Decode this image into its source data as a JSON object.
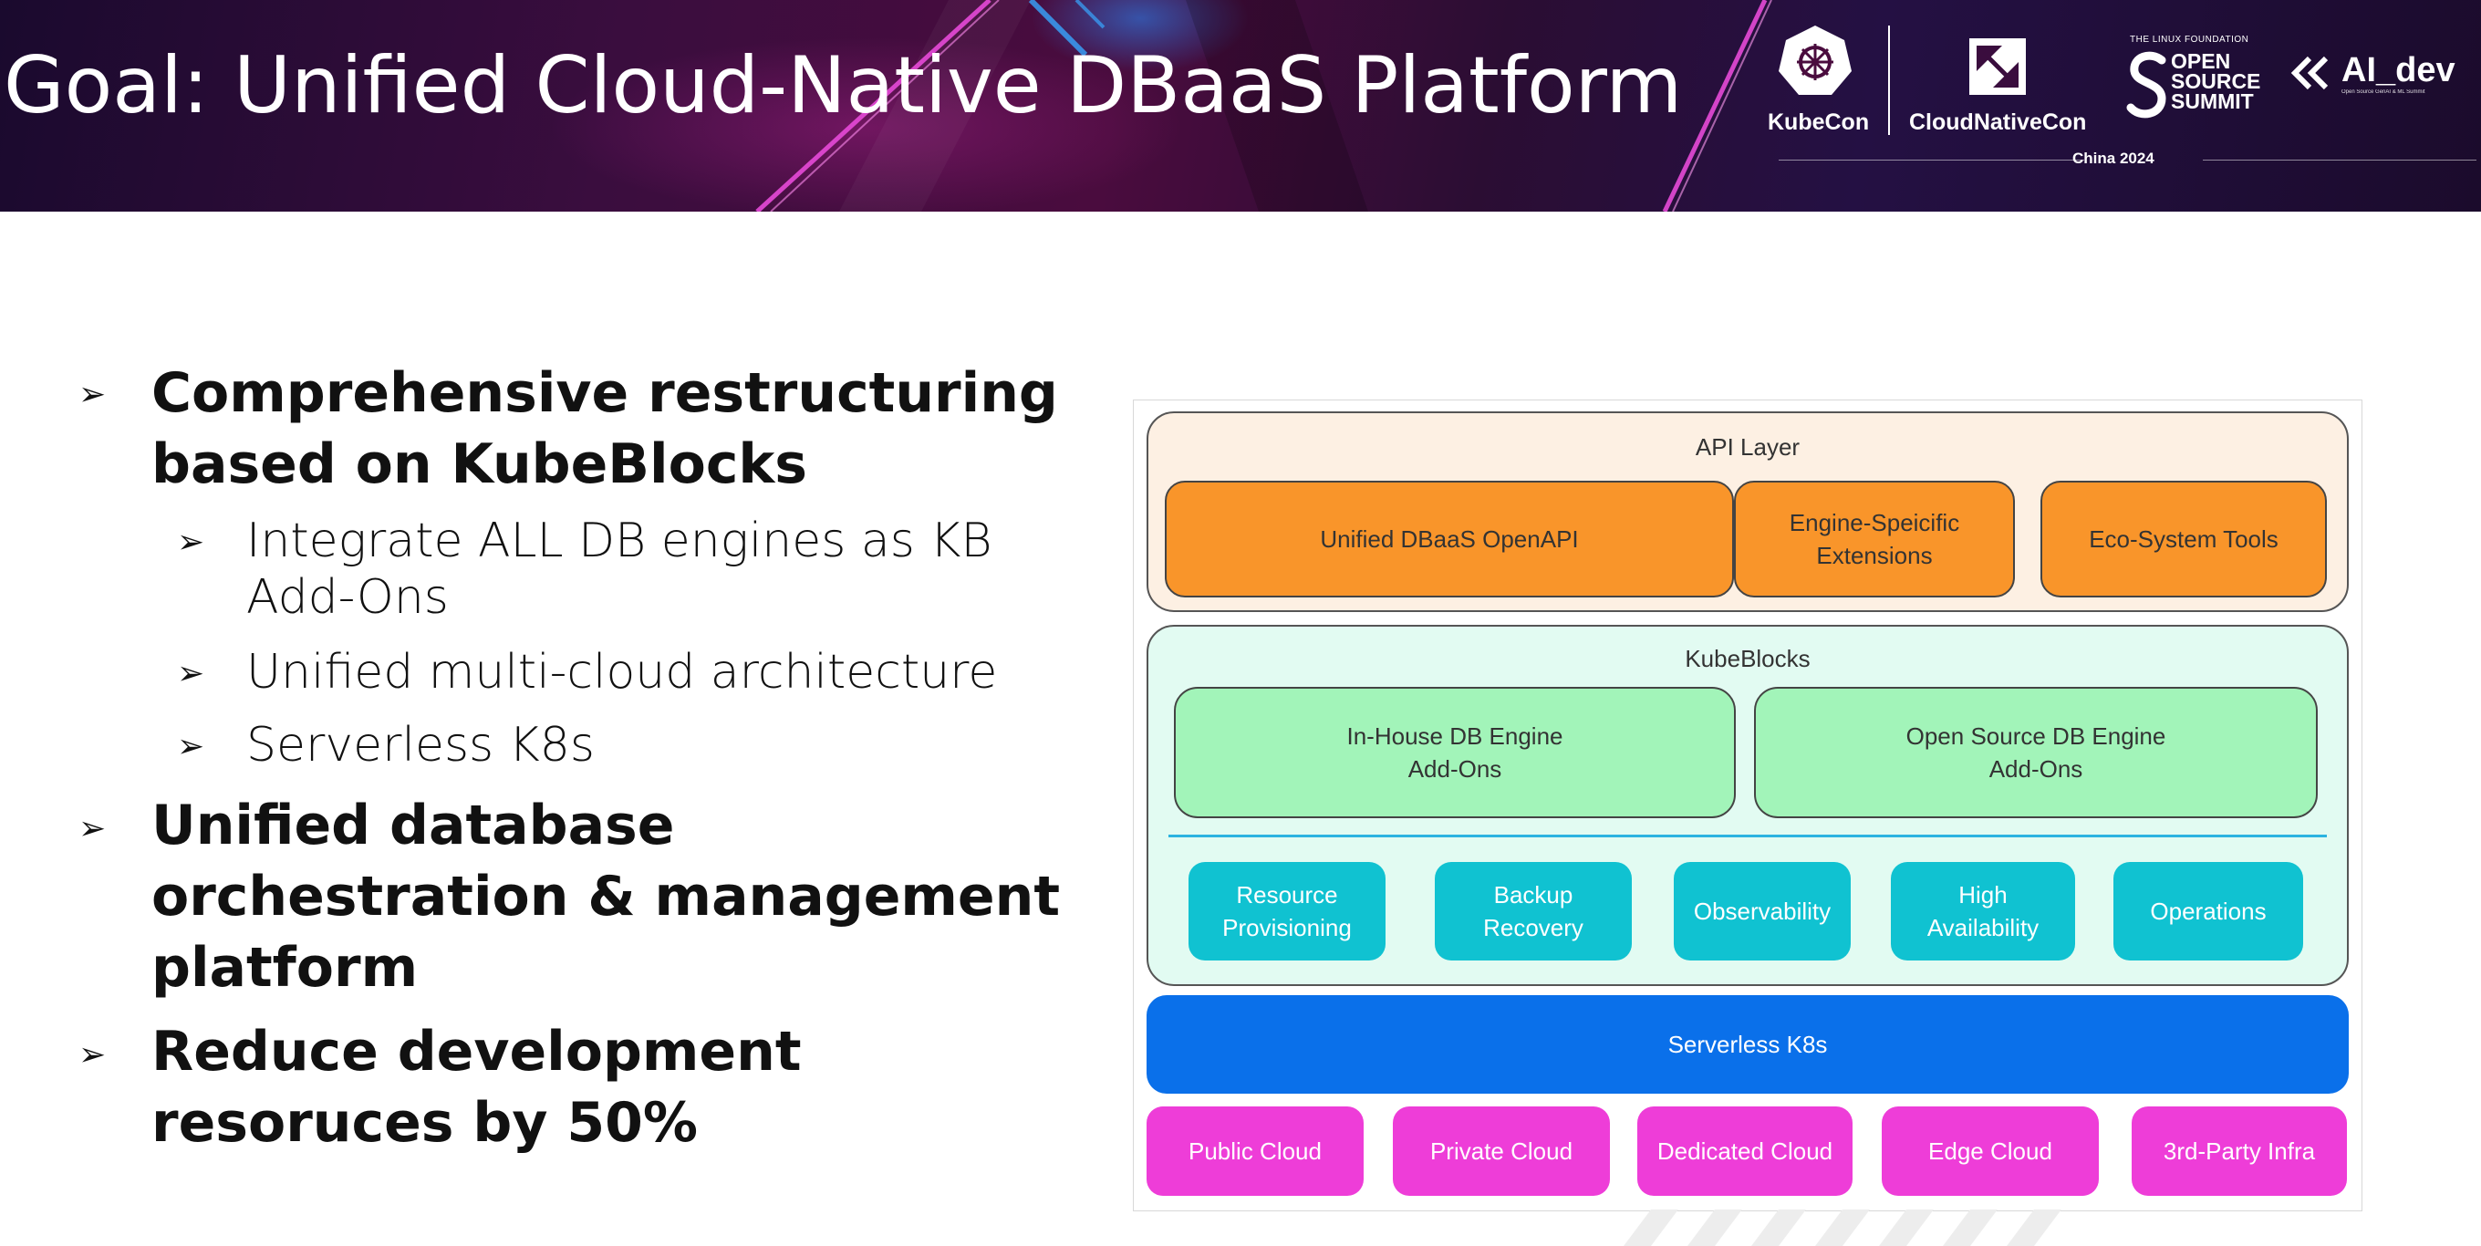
{
  "header": {
    "title": "Goal: Unified Cloud-Native DBaaS Platform",
    "logos": {
      "kubecon": "KubeCon",
      "cloudnativecon": "CloudNativeCon",
      "linux_foundation": "THE LINUX FOUNDATION",
      "oss_line1": "OPEN",
      "oss_line2": "SOURCE",
      "oss_line3": "SUMMIT",
      "aidev": "AI_dev",
      "aidev_sub": "Open Source GenAI & ML Summit",
      "event": "China 2024"
    }
  },
  "bullets": [
    {
      "level": 1,
      "lines": [
        "Comprehensive restructuring",
        "based on KubeBlocks"
      ]
    },
    {
      "level": 2,
      "lines": [
        "Integrate ALL DB engines as KB",
        "Add-Ons"
      ]
    },
    {
      "level": 2,
      "lines": [
        "Unified multi-cloud architecture"
      ]
    },
    {
      "level": 2,
      "lines": [
        "Serverless K8s"
      ]
    },
    {
      "level": 1,
      "lines": [
        "Unified database",
        "orchestration & management",
        "platform"
      ]
    },
    {
      "level": 1,
      "lines": [
        "Reduce development",
        "resoruces by 50%"
      ]
    }
  ],
  "bullet_glyph": "➢",
  "diagram": {
    "api_layer": {
      "title": "API Layer",
      "items": [
        "Unified DBaaS OpenAPI",
        "Engine-Speicific\nExtensions",
        "Eco-System Tools"
      ]
    },
    "kubeblocks": {
      "title": "KubeBlocks",
      "engines": [
        "In-House DB Engine\nAdd-Ons",
        "Open Source DB Engine\nAdd-Ons"
      ],
      "capabilities": [
        "Resource\nProvisioning",
        "Backup\nRecovery",
        "Observability",
        "High\nAvailability",
        "Operations"
      ]
    },
    "serverless": "Serverless K8s",
    "infra": [
      "Public Cloud",
      "Private Cloud",
      "Dedicated Cloud",
      "Edge Cloud",
      "3rd-Party Infra"
    ]
  },
  "colors": {
    "api_bg": "#fdf0e3",
    "kubeblocks_bg": "#e2fbf2",
    "orange": "#f9952a",
    "green": "#a2f4b9",
    "teal": "#10c2d1",
    "blue": "#0a70ea",
    "pink": "#ee3dd8"
  }
}
